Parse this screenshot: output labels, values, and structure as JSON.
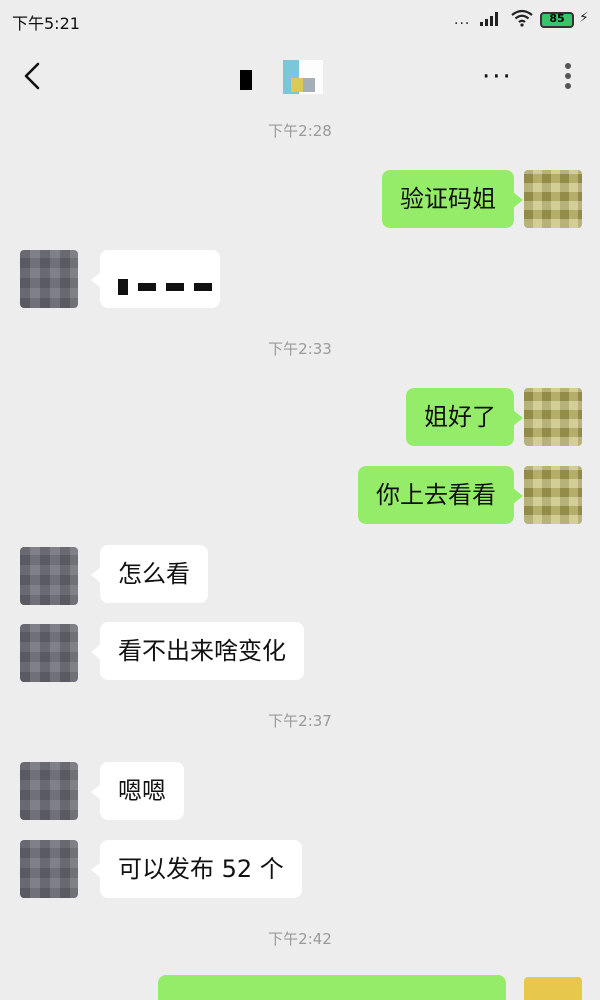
{
  "status_bar": {
    "time": "下午5:21",
    "signal_dots": "...",
    "battery_level": "85",
    "icons": [
      "signal-icon",
      "wifi-icon",
      "battery-icon",
      "charging-icon"
    ]
  },
  "nav": {
    "more_label": "···",
    "icons": [
      "back-icon",
      "more-icon",
      "kebab-icon"
    ]
  },
  "colors": {
    "background": "#ededed",
    "my_bubble": "#95ec69",
    "their_bubble": "#ffffff",
    "timestamp": "#9a9a9a"
  },
  "chat": {
    "timestamps": [
      "下午2:28",
      "下午2:33",
      "下午2:37",
      "下午2:42"
    ],
    "messages": [
      {
        "from": "me",
        "text": "验证码姐"
      },
      {
        "from": "other",
        "text": ""
      },
      {
        "from": "me",
        "text": "姐好了"
      },
      {
        "from": "me",
        "text": "你上去看看"
      },
      {
        "from": "other",
        "text": "怎么看"
      },
      {
        "from": "other",
        "text": "看不出来啥变化"
      },
      {
        "from": "other",
        "text": "嗯嗯"
      },
      {
        "from": "other",
        "text": "可以发布 52 个"
      }
    ]
  }
}
